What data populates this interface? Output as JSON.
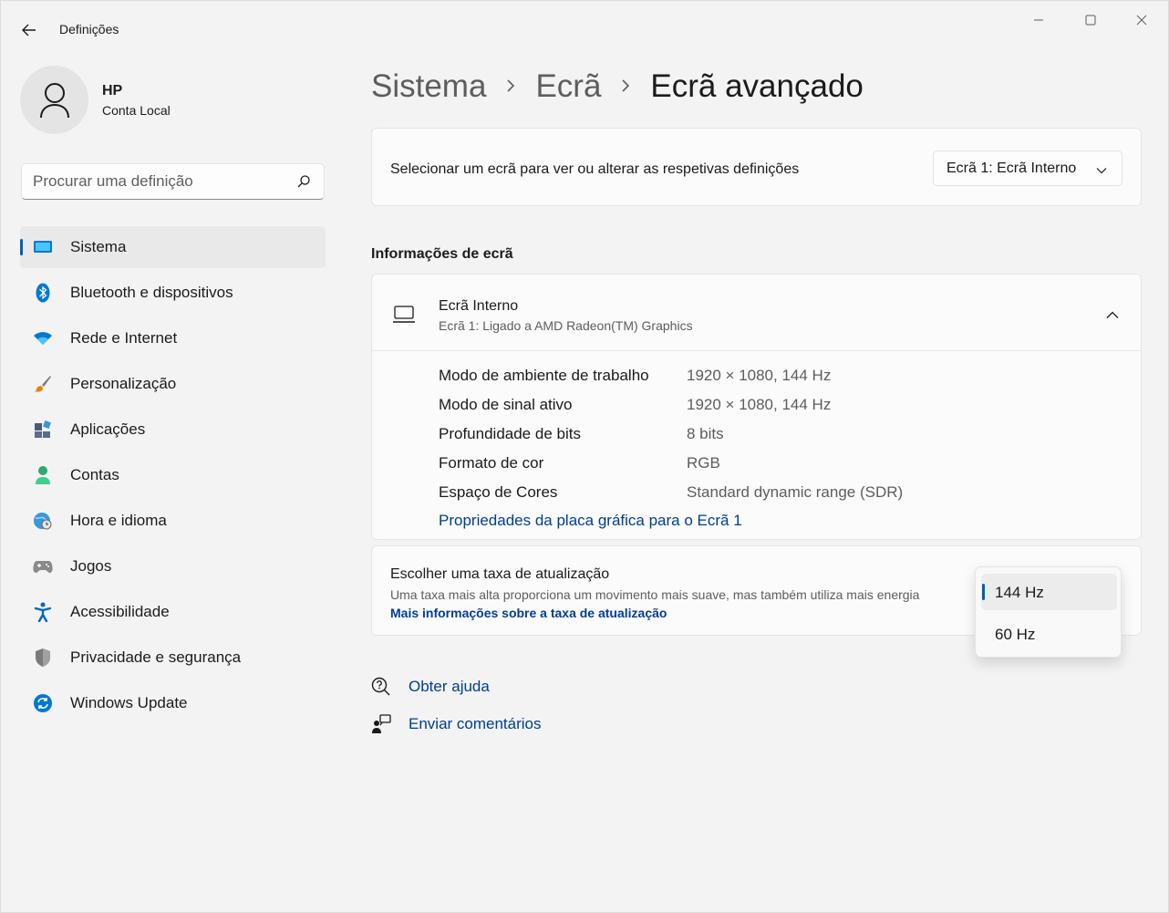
{
  "app": {
    "title": "Definições"
  },
  "window_controls": {
    "minimize": "minimize-icon",
    "maximize": "maximize-icon",
    "close": "close-icon"
  },
  "profile": {
    "name": "HP",
    "account_type": "Conta Local"
  },
  "search": {
    "placeholder": "Procurar uma definição"
  },
  "nav": {
    "items": [
      {
        "label": "Sistema",
        "icon": "system-icon",
        "active": true
      },
      {
        "label": "Bluetooth e dispositivos",
        "icon": "bluetooth-icon"
      },
      {
        "label": "Rede e Internet",
        "icon": "wifi-icon"
      },
      {
        "label": "Personalização",
        "icon": "brush-icon"
      },
      {
        "label": "Aplicações",
        "icon": "apps-icon"
      },
      {
        "label": "Contas",
        "icon": "person-icon"
      },
      {
        "label": "Hora e idioma",
        "icon": "globe-clock-icon"
      },
      {
        "label": "Jogos",
        "icon": "gamepad-icon"
      },
      {
        "label": "Acessibilidade",
        "icon": "accessibility-icon"
      },
      {
        "label": "Privacidade e segurança",
        "icon": "shield-icon"
      },
      {
        "label": "Windows Update",
        "icon": "update-icon"
      }
    ]
  },
  "breadcrumb": {
    "level1": "Sistema",
    "level2": "Ecrã",
    "current": "Ecrã avançado"
  },
  "display_select": {
    "label": "Selecionar um ecrã para ver ou alterar as respetivas definições",
    "value": "Ecrã 1: Ecrã Interno"
  },
  "display_info": {
    "section_title": "Informações de ecrã",
    "name": "Ecrã Interno",
    "subtitle": "Ecrã 1: Ligado a AMD Radeon(TM) Graphics",
    "rows": [
      {
        "key": "Modo de ambiente de trabalho",
        "value": "1920 × 1080, 144 Hz"
      },
      {
        "key": "Modo de sinal ativo",
        "value": "1920 × 1080, 144 Hz"
      },
      {
        "key": "Profundidade de bits",
        "value": "8 bits"
      },
      {
        "key": "Formato de cor",
        "value": "RGB"
      },
      {
        "key": "Espaço de Cores",
        "value": "Standard dynamic range (SDR)"
      }
    ],
    "link": "Propriedades da placa gráfica para o Ecrã 1"
  },
  "refresh_rate": {
    "title": "Escolher uma taxa de atualização",
    "description": "Uma taxa mais alta proporciona um movimento mais suave, mas também utiliza mais energia",
    "link": "Mais informações sobre a taxa de atualização",
    "options": [
      {
        "label": "144 Hz",
        "selected": true
      },
      {
        "label": "60 Hz",
        "selected": false
      }
    ]
  },
  "help": {
    "get_help": "Obter ajuda",
    "feedback": "Enviar comentários"
  },
  "colors": {
    "accent": "#005fb8",
    "link": "#003e92",
    "background": "#f3f3f3",
    "card": "#fbfbfb"
  }
}
